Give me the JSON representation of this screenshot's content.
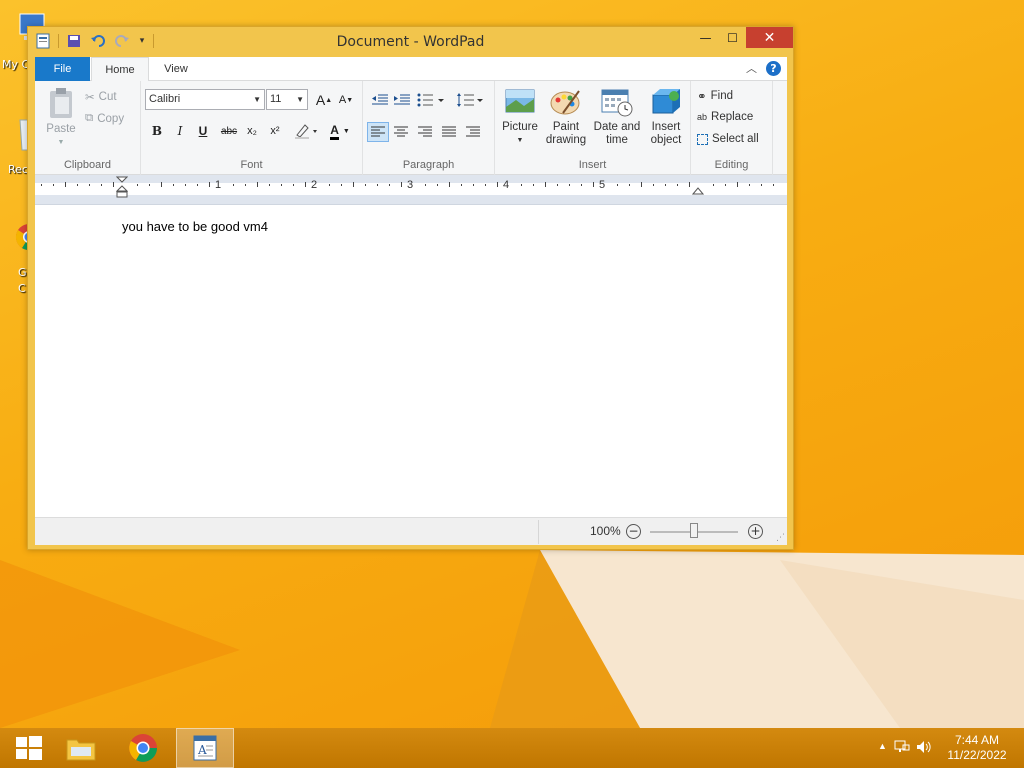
{
  "desktop": {
    "icons": [
      {
        "label": "My C",
        "name": "my-computer"
      },
      {
        "label": "Rec",
        "name": "recycle-bin"
      },
      {
        "label": "G",
        "name": "google-chrome",
        "label2": "C"
      }
    ]
  },
  "window": {
    "title": "Document - WordPad",
    "buttons": {
      "minimize": "—",
      "maximize": "☐",
      "close": "✕"
    }
  },
  "tabs": [
    {
      "label": "File"
    },
    {
      "label": "Home"
    },
    {
      "label": "View"
    }
  ],
  "help_label": "?",
  "ribbon": {
    "clipboard": {
      "paste": "Paste",
      "cut": "Cut",
      "copy": "Copy",
      "group": "Clipboard"
    },
    "font": {
      "family": "Calibri",
      "size": "11",
      "group": "Font",
      "bold": "B",
      "italic": "I",
      "underline": "U",
      "strike": "abc",
      "sub": "x₂",
      "sup": "x²",
      "grow": "A",
      "shrink": "A",
      "color": "A"
    },
    "paragraph": {
      "group": "Paragraph"
    },
    "insert": {
      "group": "Insert",
      "picture": "Picture",
      "paint_line1": "Paint",
      "paint_line2": "drawing",
      "date_line1": "Date and",
      "date_line2": "time",
      "object_line1": "Insert",
      "object_line2": "object"
    },
    "editing": {
      "group": "Editing",
      "find": "Find",
      "replace": "Replace",
      "select_all": "Select all"
    }
  },
  "ruler": {
    "numbers": [
      "1",
      "2",
      "3",
      "4",
      "5"
    ]
  },
  "document": {
    "text": "you have to be good vm4"
  },
  "status": {
    "zoom": "100%",
    "zoom_out": "−",
    "zoom_in": "+"
  },
  "taskbar": {
    "time": "7:44 AM",
    "date": "11/22/2022"
  },
  "colors": {
    "accent": "#1979ca",
    "frame": "#f2c54c",
    "close": "#c7402f",
    "desktop": "#f8ad12"
  }
}
